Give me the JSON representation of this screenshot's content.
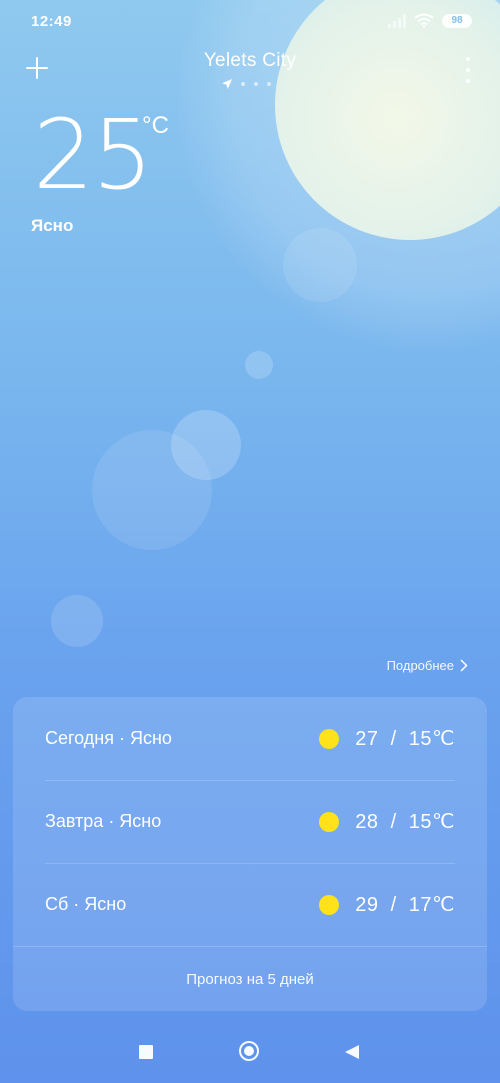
{
  "status_bar": {
    "time": "12:49",
    "battery_level": "98"
  },
  "header": {
    "city": "Yelets City",
    "page_count": 4,
    "active_page": 0
  },
  "current": {
    "temperature": "25",
    "unit": "°C",
    "condition": "Ясно"
  },
  "details_link": {
    "label": "Подробнее"
  },
  "forecast": {
    "days": [
      {
        "label": "Сегодня · Ясно",
        "icon": "sun-icon",
        "temp": "27  /  15℃"
      },
      {
        "label": "Завтра · Ясно",
        "icon": "sun-icon",
        "temp": "28  /  15℃"
      },
      {
        "label": "Сб · Ясно",
        "icon": "sun-icon",
        "temp": "29  /  17℃"
      }
    ],
    "five_day_label": "Прогноз на 5 дней"
  },
  "colors": {
    "background_top": "#8fc9ef",
    "background_bottom": "#5e92ec",
    "sun_icon": "#ffe21a",
    "text": "#ffffff"
  }
}
